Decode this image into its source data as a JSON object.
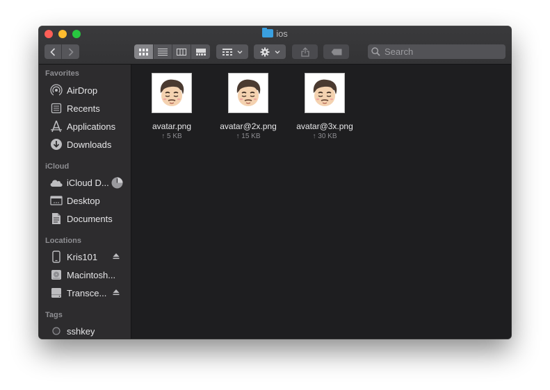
{
  "window": {
    "title": "ios",
    "colors": {
      "close": "#fe5f57",
      "minimize": "#febc2e",
      "maximize": "#28c840",
      "folder": "#3aa0e0"
    }
  },
  "toolbar": {
    "back_icon": "chevron-left-icon",
    "forward_icon": "chevron-right-icon",
    "view_modes": [
      "icon-view-icon",
      "list-view-icon",
      "column-view-icon",
      "gallery-view-icon"
    ],
    "active_view": 0,
    "search_placeholder": "Search"
  },
  "sidebar": {
    "favorites": {
      "title": "Favorites",
      "items": [
        {
          "label": "AirDrop",
          "icon": "airdrop-icon"
        },
        {
          "label": "Recents",
          "icon": "recents-icon"
        },
        {
          "label": "Applications",
          "icon": "applications-icon"
        },
        {
          "label": "Downloads",
          "icon": "downloads-icon"
        }
      ]
    },
    "icloud": {
      "title": "iCloud",
      "items": [
        {
          "label": "iCloud D...",
          "icon": "cloud-icon"
        },
        {
          "label": "Desktop",
          "icon": "desktop-icon"
        },
        {
          "label": "Documents",
          "icon": "document-icon"
        }
      ]
    },
    "locations": {
      "title": "Locations",
      "items": [
        {
          "label": "Kris101",
          "icon": "phone-icon"
        },
        {
          "label": "Macintosh...",
          "icon": "hard-drive-icon"
        },
        {
          "label": "Transce...",
          "icon": "external-drive-icon"
        }
      ]
    },
    "tags": {
      "title": "Tags",
      "items": [
        {
          "label": "sshkey",
          "icon": "tag-circle-icon"
        }
      ]
    }
  },
  "files": [
    {
      "name": "avatar.png",
      "size": "↑ 5 KB"
    },
    {
      "name": "avatar@2x.png",
      "size": "↑ 15 KB"
    },
    {
      "name": "avatar@3x.png",
      "size": "↑ 30 KB"
    }
  ]
}
